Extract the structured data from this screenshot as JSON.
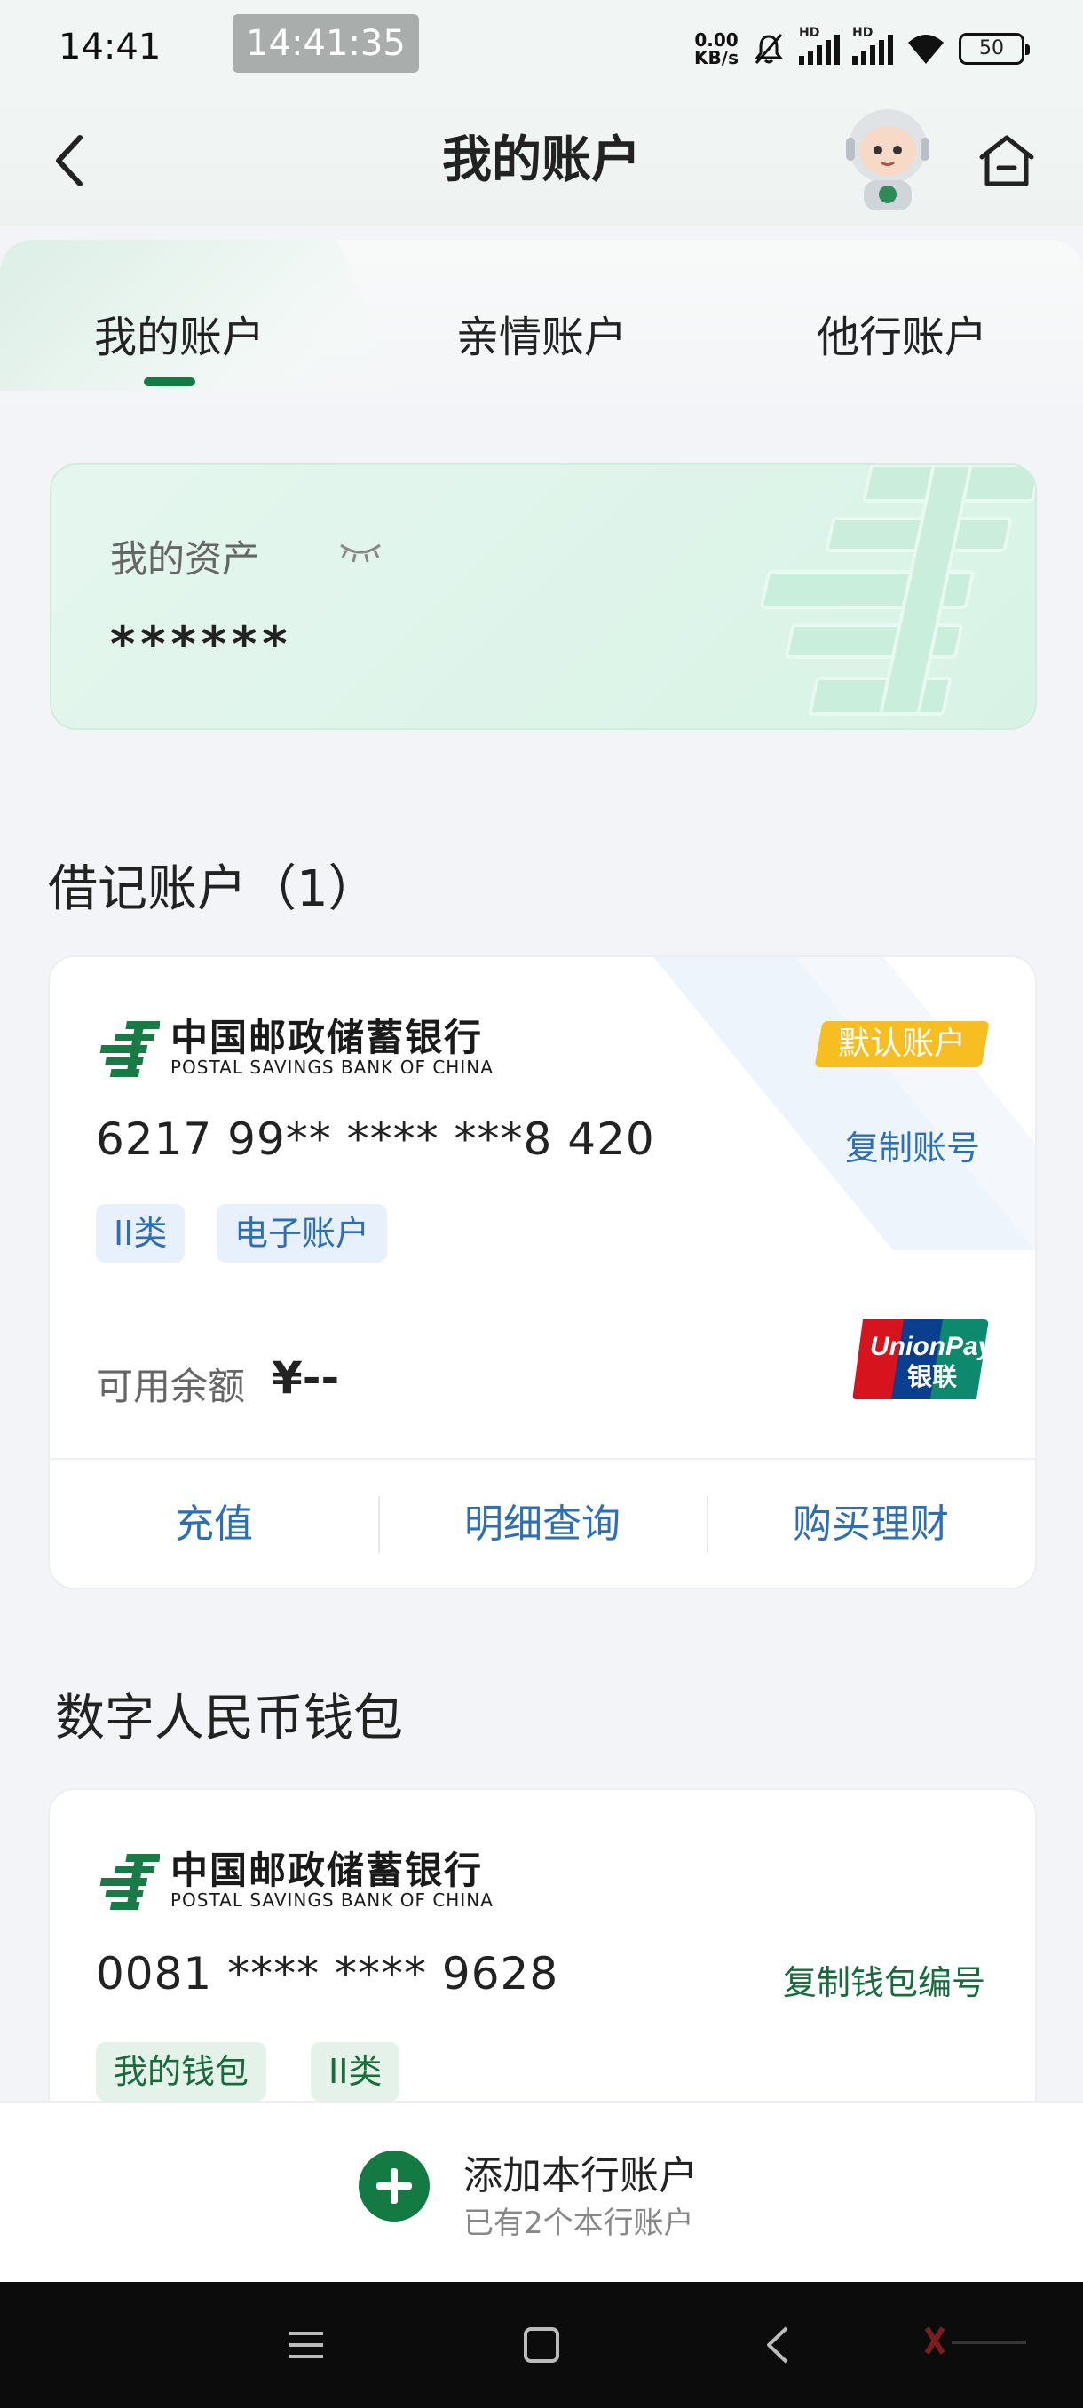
{
  "status_bar": {
    "time": "14:41",
    "recording_time": "14:41:35",
    "net_speed_value": "0.00",
    "net_speed_unit": "KB/s",
    "signal_label": "HD",
    "battery": "50"
  },
  "header": {
    "title": "我的账户",
    "back_icon": "chevron-left-icon",
    "assistant_icon": "robot-assistant-icon",
    "home_icon": "home-icon"
  },
  "tabs": [
    {
      "label": "我的账户",
      "active": true
    },
    {
      "label": "亲情账户",
      "active": false
    },
    {
      "label": "他行账户",
      "active": false
    }
  ],
  "assets": {
    "label": "我的资产",
    "value": "******",
    "visibility_icon": "eye-closed-icon"
  },
  "debit_section": {
    "title": "借记账户（1）"
  },
  "debit_card": {
    "bank_name_cn": "中国邮政储蓄银行",
    "bank_name_en": "POSTAL SAVINGS BANK OF CHINA",
    "default_badge": "默认账户",
    "account_number": "6217 99** **** ***8 420",
    "copy_label": "复制账号",
    "tags": [
      "II类",
      "电子账户"
    ],
    "balance_label": "可用余额",
    "balance_value": "¥--",
    "card_network_top": "UnionPay",
    "card_network_bottom": "银联",
    "actions": [
      "充值",
      "明细查询",
      "购买理财"
    ]
  },
  "wallet_section": {
    "title": "数字人民币钱包"
  },
  "wallet_card": {
    "bank_name_cn": "中国邮政储蓄银行",
    "bank_name_en": "POSTAL SAVINGS BANK OF CHINA",
    "wallet_number": "0081 **** **** 9628",
    "copy_label": "复制钱包编号",
    "tags": [
      "我的钱包",
      "II类"
    ]
  },
  "add_account": {
    "title": "添加本行账户",
    "subtitle": "已有2个本行账户"
  },
  "colors": {
    "brand_green": "#137a44",
    "link_blue": "#2c6fb6",
    "badge_yellow": "#f6be21"
  }
}
